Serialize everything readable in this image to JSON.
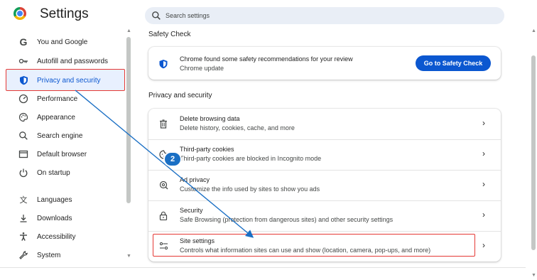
{
  "header": {
    "app_title": "Settings",
    "search_placeholder": "Search settings"
  },
  "sidebar": {
    "items": [
      {
        "label": "You and Google",
        "icon": "google-g-icon",
        "active": false
      },
      {
        "label": "Autofill and passwords",
        "icon": "key-icon",
        "active": false
      },
      {
        "label": "Privacy and security",
        "icon": "shield-icon",
        "active": true
      },
      {
        "label": "Performance",
        "icon": "speedometer-icon",
        "active": false
      },
      {
        "label": "Appearance",
        "icon": "palette-icon",
        "active": false
      },
      {
        "label": "Search engine",
        "icon": "search-icon",
        "active": false
      },
      {
        "label": "Default browser",
        "icon": "browser-window-icon",
        "active": false
      },
      {
        "label": "On startup",
        "icon": "power-icon",
        "active": false
      },
      {
        "label": "Languages",
        "icon": "translate-icon",
        "active": false
      },
      {
        "label": "Downloads",
        "icon": "download-icon",
        "active": false
      },
      {
        "label": "Accessibility",
        "icon": "accessibility-icon",
        "active": false
      },
      {
        "label": "System",
        "icon": "wrench-icon",
        "active": false
      }
    ]
  },
  "safety_check": {
    "section_title": "Safety Check",
    "title": "Chrome found some safety recommendations for your review",
    "subtitle": "Chrome update",
    "button_label": "Go to Safety Check"
  },
  "privacy": {
    "section_title": "Privacy and security",
    "rows": [
      {
        "title": "Delete browsing data",
        "subtitle": "Delete history, cookies, cache, and more",
        "icon": "trash-icon"
      },
      {
        "title": "Third-party cookies",
        "subtitle": "Third-party cookies are blocked in Incognito mode",
        "icon": "cookie-icon"
      },
      {
        "title": "Ad privacy",
        "subtitle": "Customize the info used by sites to show you ads",
        "icon": "ad-privacy-icon"
      },
      {
        "title": "Security",
        "subtitle": "Safe Browsing (protection from dangerous sites) and other security settings",
        "icon": "lock-icon"
      },
      {
        "title": "Site settings",
        "subtitle": "Controls what information sites can use and show (location, camera, pop-ups, and more)",
        "icon": "sliders-icon"
      }
    ]
  },
  "annotation": {
    "step_number": "2"
  },
  "colors": {
    "accent": "#0b57d0",
    "highlight": "#e53935",
    "badge": "#1a6fc4"
  }
}
